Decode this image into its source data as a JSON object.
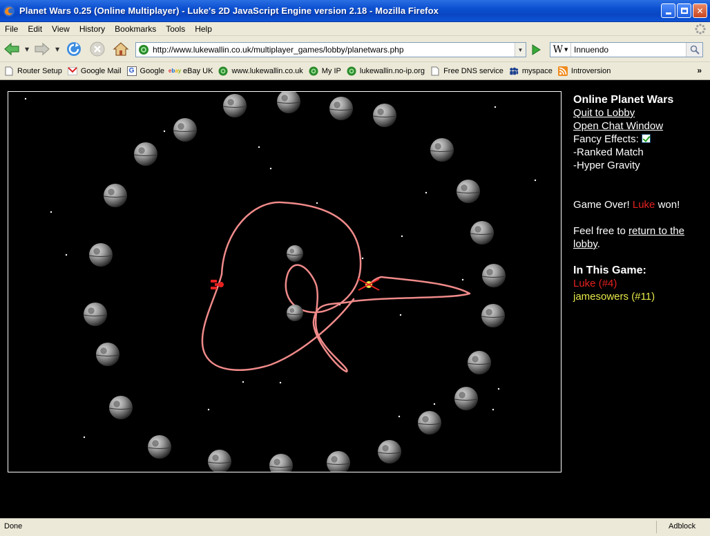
{
  "window": {
    "title": "Planet Wars 0.25 (Online Multiplayer) - Luke's 2D JavaScript Engine version 2.18 - Mozilla Firefox"
  },
  "menu": [
    "File",
    "Edit",
    "View",
    "History",
    "Bookmarks",
    "Tools",
    "Help"
  ],
  "nav": {
    "url": "http://www.lukewallin.co.uk/multiplayer_games/lobby/planetwars.php",
    "search_engine": "W",
    "search_value": "Innuendo"
  },
  "bookmarks": [
    {
      "label": "Router Setup",
      "icon": "page-icon"
    },
    {
      "label": "Google Mail",
      "icon": "gmail-icon"
    },
    {
      "label": "Google",
      "icon": "google-icon"
    },
    {
      "label": "eBay UK",
      "icon": "ebay-icon"
    },
    {
      "label": "www.lukewallin.co.uk",
      "icon": "site-icon"
    },
    {
      "label": "My IP",
      "icon": "site-icon"
    },
    {
      "label": "lukewallin.no-ip.org",
      "icon": "site-icon"
    },
    {
      "label": "Free DNS service",
      "icon": "page-icon"
    },
    {
      "label": "myspace",
      "icon": "myspace-icon"
    },
    {
      "label": "Introversion",
      "icon": "rss-icon"
    }
  ],
  "game": {
    "title": "Online Planet Wars",
    "quit_link": "Quit to Lobby",
    "chat_link": "Open Chat Window",
    "fancy_effects_label": "Fancy Effects:",
    "fancy_effects_checked": true,
    "option1": "-Ranked Match",
    "option2": "-Hyper Gravity",
    "game_over_prefix": "Game Over!",
    "winner": "Luke",
    "game_over_suffix": "won!",
    "return_prefix": "Feel free to",
    "return_link_1": "return to the",
    "return_link_2": "lobby",
    "return_suffix": ".",
    "players_heading": "In This Game:",
    "players": [
      {
        "name": "Luke (#4)",
        "color": "#e52020"
      },
      {
        "name": "jamesowers (#11)",
        "color": "#e6e84a"
      }
    ]
  },
  "status": {
    "text": "Done",
    "addon": "Adblock"
  },
  "colors": {
    "titlebar": "#0b4fd0",
    "chrome": "#ece9d8",
    "trail": "#f08a8a",
    "player_red": "#e52020",
    "player_yellow": "#e6e84a"
  }
}
